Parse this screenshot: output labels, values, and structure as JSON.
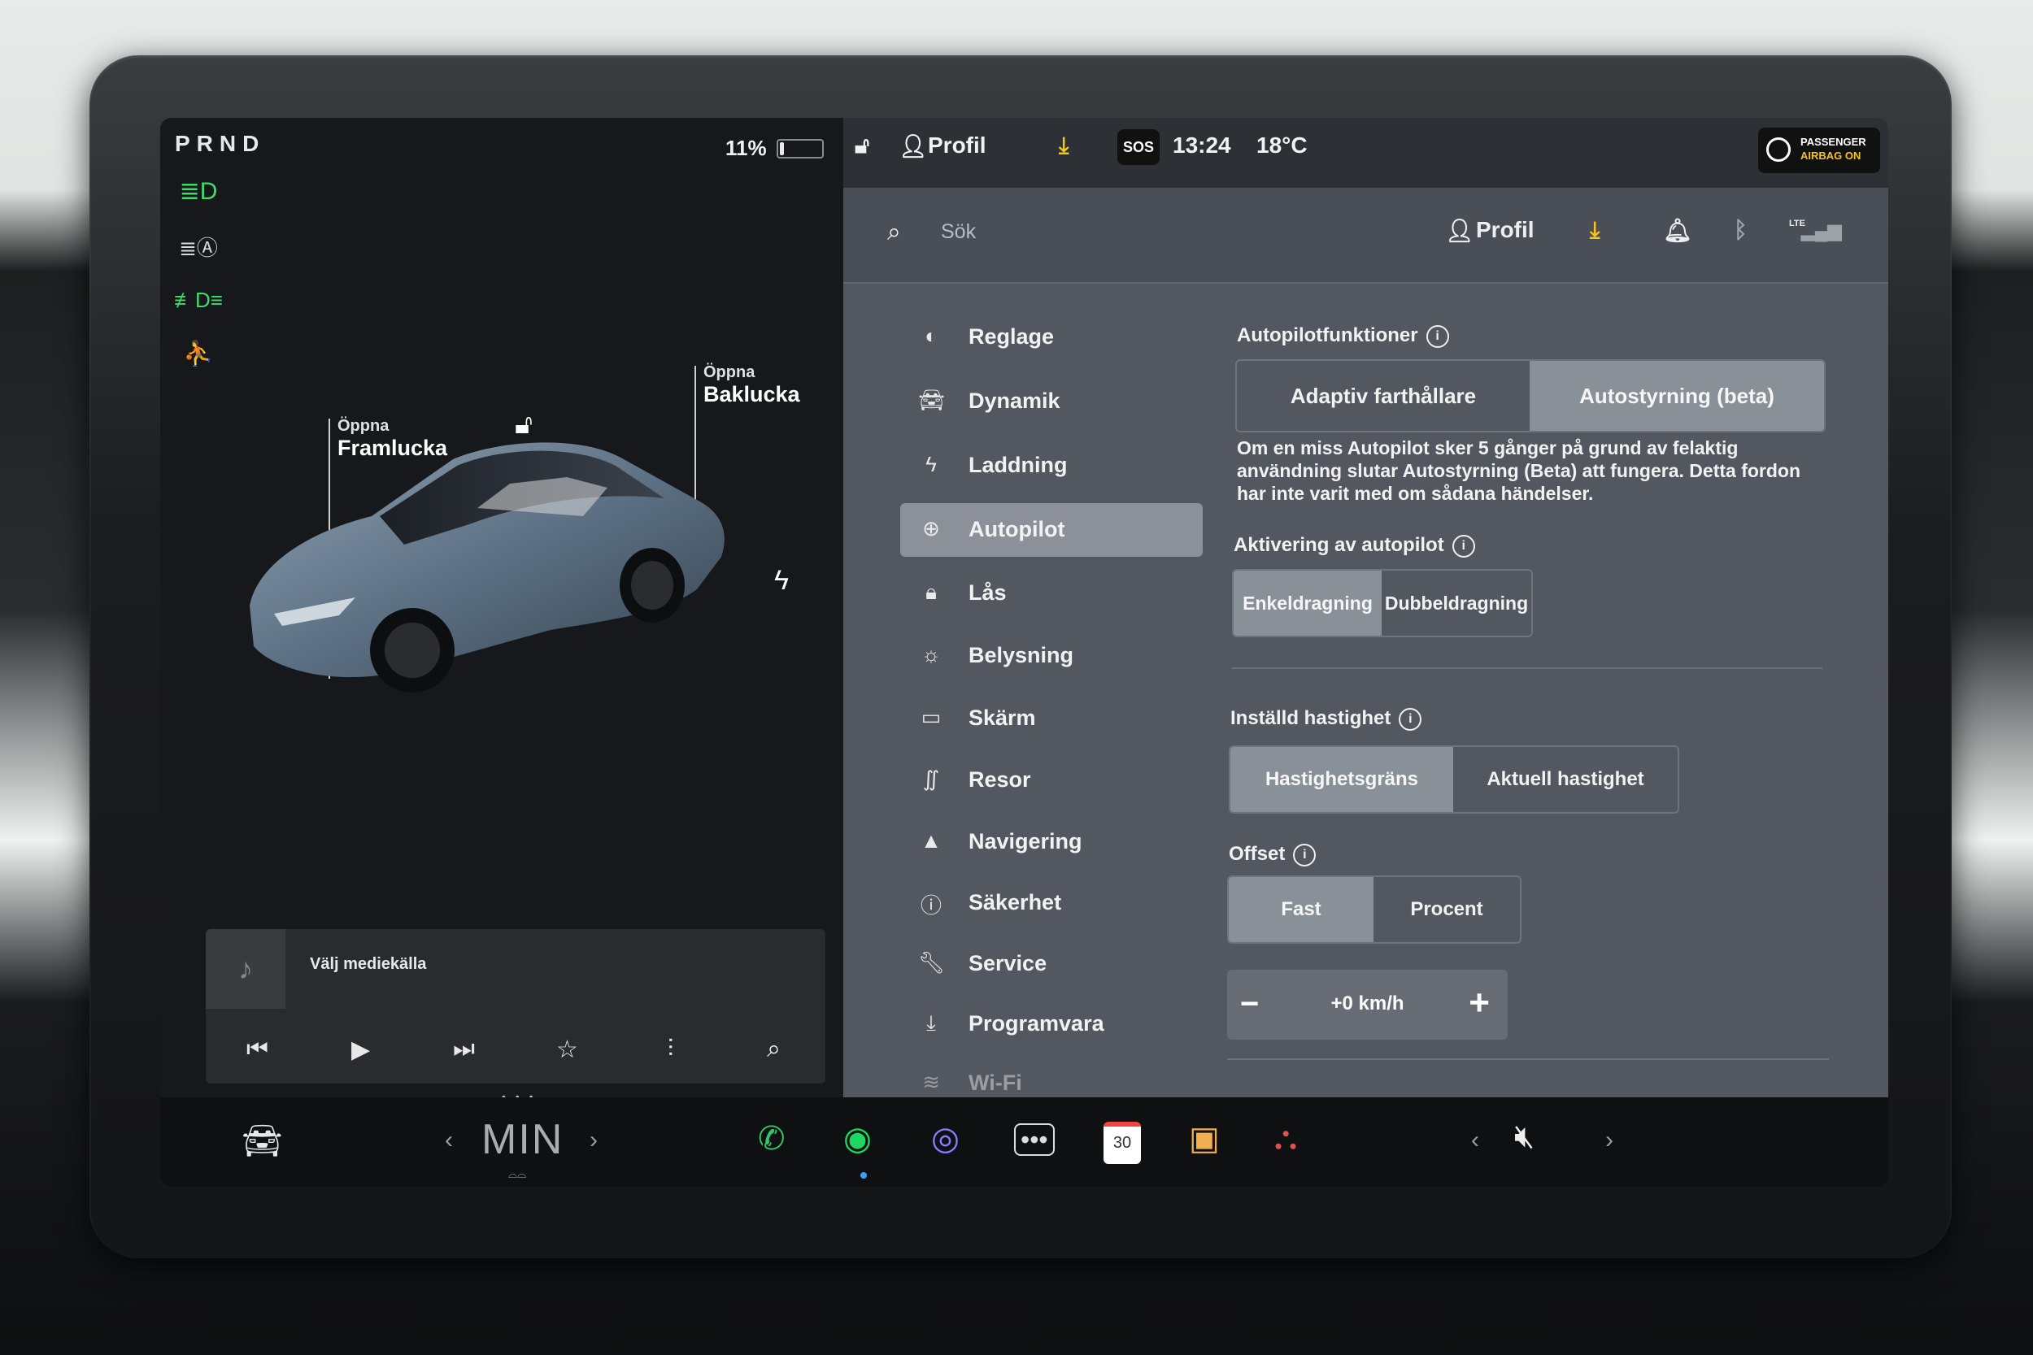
{
  "status": {
    "gear": "PRND",
    "battery_percent": "11%",
    "battery_level": 0.11,
    "time": "13:24",
    "temperature": "18°C",
    "profile_label": "Profil",
    "sos_label": "SOS",
    "airbag_line1": "PASSENGER",
    "airbag_line2": "AIRBAG ON"
  },
  "car_view": {
    "frunk_small": "Öppna",
    "frunk_big": "Framlucka",
    "trunk_small": "Öppna",
    "trunk_big": "Baklucka"
  },
  "media": {
    "title": "Välj mediekälla"
  },
  "search": {
    "placeholder": "Sök",
    "profile_label": "Profil",
    "lte_label": "LTE"
  },
  "nav": {
    "items": [
      {
        "label": "Reglage",
        "icon": "toggle-icon"
      },
      {
        "label": "Dynamik",
        "icon": "car-icon"
      },
      {
        "label": "Laddning",
        "icon": "bolt-icon"
      },
      {
        "label": "Autopilot",
        "icon": "steering-wheel-icon"
      },
      {
        "label": "Lås",
        "icon": "lock-icon"
      },
      {
        "label": "Belysning",
        "icon": "sun-icon"
      },
      {
        "label": "Skärm",
        "icon": "display-icon"
      },
      {
        "label": "Resor",
        "icon": "trips-icon"
      },
      {
        "label": "Navigering",
        "icon": "navigation-icon"
      },
      {
        "label": "Säkerhet",
        "icon": "safety-icon"
      },
      {
        "label": "Service",
        "icon": "wrench-icon"
      },
      {
        "label": "Programvara",
        "icon": "download-icon"
      },
      {
        "label": "Wi-Fi",
        "icon": "wifi-icon"
      }
    ],
    "active": "Autopilot"
  },
  "autopilot": {
    "features_title": "Autopilotfunktioner",
    "features_options": [
      "Adaptiv farthållare",
      "Autostyrning (beta)"
    ],
    "features_selected": "Autostyrning (beta)",
    "description": "Om en miss Autopilot sker 5 gånger på grund av felaktig användning slutar Autostyrning (Beta) att fungera. Detta fordon har inte varit med om sådana händelser.",
    "activation_title": "Aktivering av autopilot",
    "activation_options": [
      "Enkeldragning",
      "Dubbeldragning"
    ],
    "activation_selected": "Enkeldragning",
    "speed_title": "Inställd hastighet",
    "speed_options": [
      "Hastighetsgräns",
      "Aktuell hastighet"
    ],
    "speed_selected": "Hastighetsgräns",
    "offset_title": "Offset",
    "offset_options": [
      "Fast",
      "Procent"
    ],
    "offset_selected": "Fast",
    "offset_value": "+0 km/h"
  },
  "dock": {
    "climate_temp": "MIN",
    "calendar_day": "30"
  },
  "colors": {
    "indicator_green": "#3ddc6a",
    "seatbelt_red": "#ff4d4d",
    "download_yellow": "#f6c21b",
    "phone_green": "#2ec866",
    "spotify_green": "#1ed760"
  }
}
